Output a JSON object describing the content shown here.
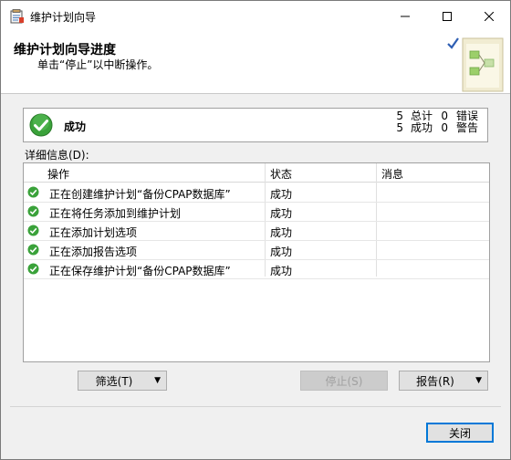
{
  "window": {
    "title": "维护计划向导"
  },
  "banner": {
    "title": "维护计划向导进度",
    "subtitle": "单击“停止”以中断操作。"
  },
  "status": {
    "text": "成功",
    "total_count": "5",
    "total_label": "总计",
    "success_count": "5",
    "success_label": "成功",
    "error_count": "0",
    "error_label": "错误",
    "warning_count": "0",
    "warning_label": "警告"
  },
  "details": {
    "label": "详细信息(D):",
    "columns": [
      "操作",
      "状态",
      "消息"
    ],
    "rows": [
      {
        "action": "正在创建维护计划“备份CPAP数据库”",
        "status": "成功",
        "message": ""
      },
      {
        "action": "正在将任务添加到维护计划",
        "status": "成功",
        "message": ""
      },
      {
        "action": "正在添加计划选项",
        "status": "成功",
        "message": ""
      },
      {
        "action": "正在添加报告选项",
        "status": "成功",
        "message": ""
      },
      {
        "action": "正在保存维护计划“备份CPAP数据库”",
        "status": "成功",
        "message": ""
      }
    ]
  },
  "buttons": {
    "filter": "筛选(T)",
    "stop": "停止(S)",
    "report": "报告(R)",
    "close": "关闭"
  },
  "colors": {
    "success_green": "#3aa23a",
    "accent_blue": "#0078d7"
  }
}
